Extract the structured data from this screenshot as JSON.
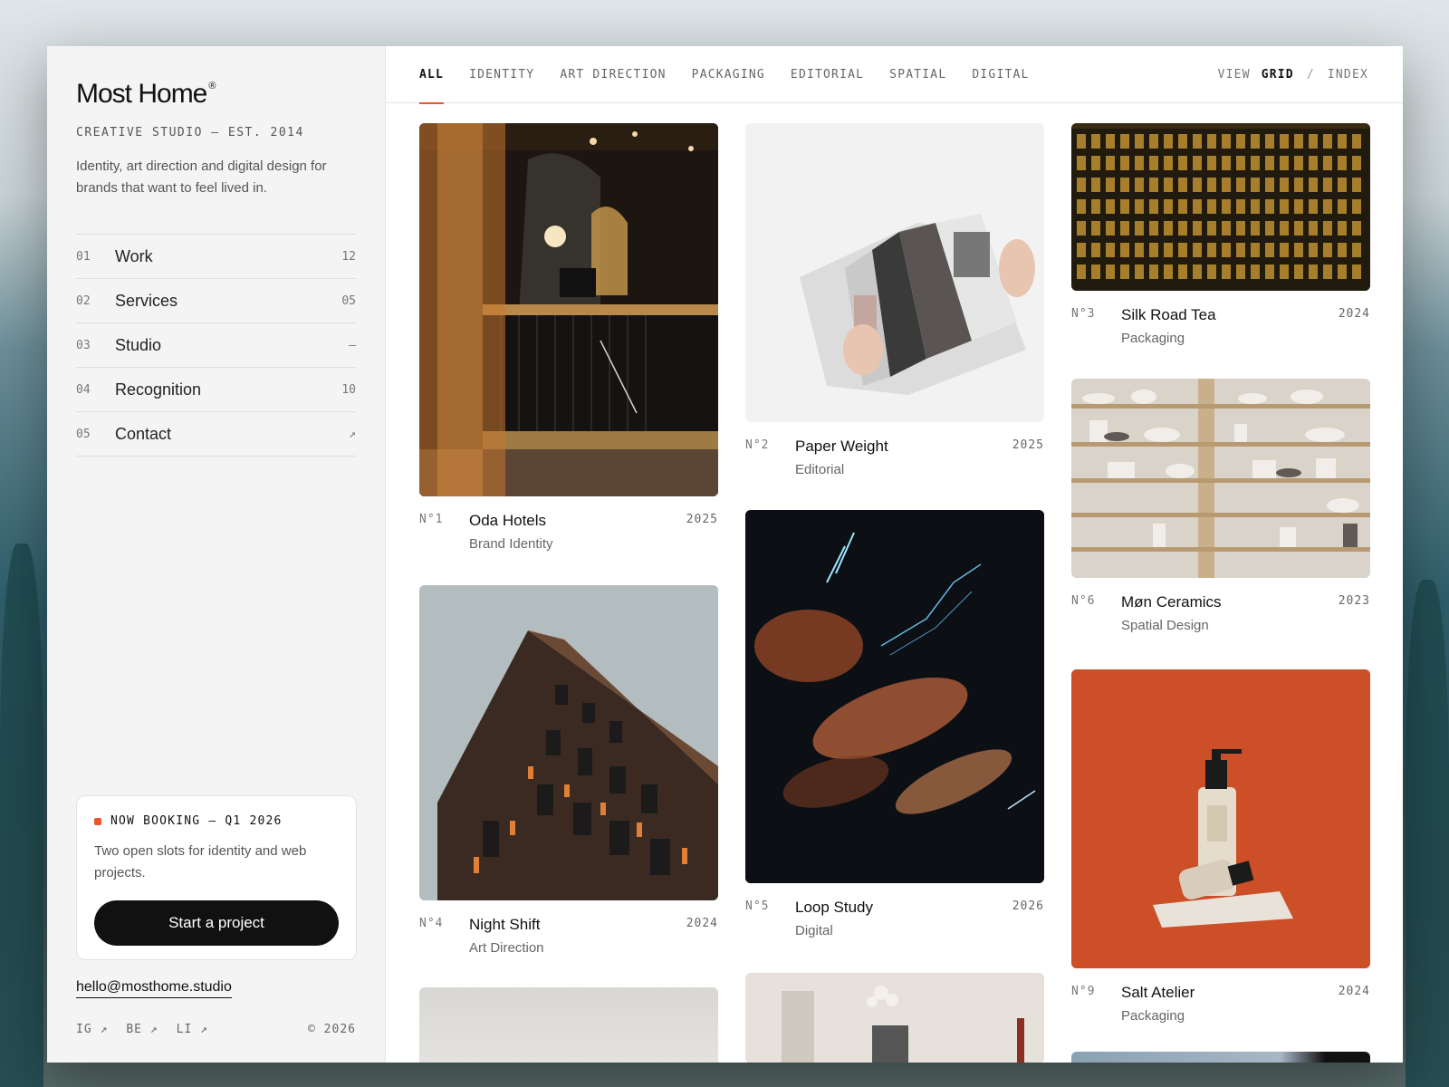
{
  "brand": {
    "name": "Most Home",
    "reg_mark": "®",
    "tagline": "CREATIVE STUDIO — EST. 2014",
    "intro": "Identity, art direction and digital design for brands that want to feel lived in."
  },
  "nav": [
    {
      "num": "01",
      "label": "Work",
      "count": "12"
    },
    {
      "num": "02",
      "label": "Services",
      "count": "05"
    },
    {
      "num": "03",
      "label": "Studio",
      "count": "—"
    },
    {
      "num": "04",
      "label": "Recognition",
      "count": "10"
    },
    {
      "num": "05",
      "label": "Contact",
      "count": "↗"
    }
  ],
  "booking": {
    "status": "NOW BOOKING — Q1 2026",
    "text": "Two open slots for identity and web projects.",
    "cta": "Start a project",
    "accent": "#e8562a"
  },
  "contact": {
    "email": "hello@mosthome.studio",
    "socials": [
      "IG ↗",
      "BE ↗",
      "LI ↗"
    ],
    "copyright": "© 2026"
  },
  "filters": {
    "tabs": [
      "ALL",
      "IDENTITY",
      "ART DIRECTION",
      "PACKAGING",
      "EDITORIAL",
      "SPATIAL",
      "DIGITAL"
    ],
    "active": "ALL"
  },
  "view": {
    "label": "VIEW",
    "options": [
      "GRID",
      "INDEX"
    ],
    "active": "GRID",
    "separator": "/"
  },
  "projects": [
    {
      "num": "N°1",
      "title": "Oda Hotels",
      "category": "Brand Identity",
      "year": "2025"
    },
    {
      "num": "N°2",
      "title": "Paper Weight",
      "category": "Editorial",
      "year": "2025"
    },
    {
      "num": "N°3",
      "title": "Silk Road Tea",
      "category": "Packaging",
      "year": "2024"
    },
    {
      "num": "N°4",
      "title": "Night Shift",
      "category": "Art Direction",
      "year": "2024"
    },
    {
      "num": "N°5",
      "title": "Loop Study",
      "category": "Digital",
      "year": "2026"
    },
    {
      "num": "N°6",
      "title": "Møn Ceramics",
      "category": "Spatial Design",
      "year": "2023"
    },
    {
      "num": "N°9",
      "title": "Salt Atelier",
      "category": "Packaging",
      "year": "2024"
    }
  ]
}
